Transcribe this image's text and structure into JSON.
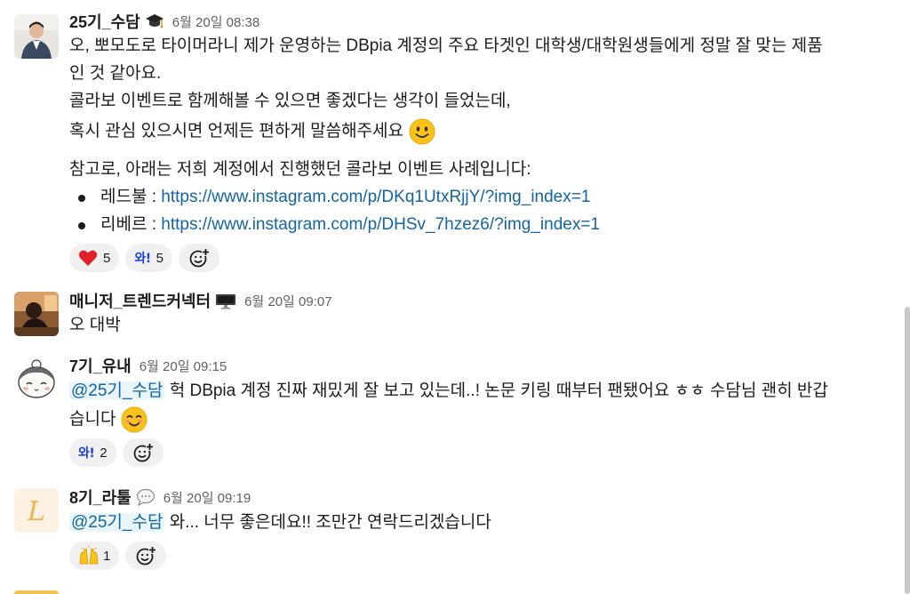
{
  "messages": [
    {
      "author": "25기_수담",
      "status_icon": "graduation-cap-icon",
      "time": "6월 20일 08:38",
      "lines": [
        "오, 뽀모도로 타이머라니 제가 운영하는 DBpia 계정의 주요 타겟인 대학생/대학원생들에게 정말 잘 맞는 제품",
        "인 것 같아요.",
        "콜라보 이벤트로 함께해볼 수 있으면 좋겠다는 생각이 들었는데,",
        "혹시 관심 있으시면 언제든 편하게 말씀해주세요"
      ],
      "paragraph2": "참고로, 아래는 저희 계정에서 진행했던 콜라보 이벤트 사례입니다:",
      "bullets": [
        {
          "label": "레드불 : ",
          "url": "https://www.instagram.com/p/DKq1UtxRjjY/?img_index=1"
        },
        {
          "label": "리베르 : ",
          "url": "https://www.instagram.com/p/DHSv_7hzez6/?img_index=1"
        }
      ],
      "reactions": [
        {
          "emoji": "heart",
          "count": "5"
        },
        {
          "emoji": "와!",
          "count": "5"
        }
      ]
    },
    {
      "author": "매니저_트렌드커넥터",
      "status_icon": "computer-monitor-icon",
      "time": "6월 20일 09:07",
      "text": "오 대박"
    },
    {
      "author": "7기_유내",
      "time": "6월 20일 09:15",
      "mention": "@25기_수담",
      "text_after_mention": " 헉 DBpia 계정 진짜 재밌게 잘 보고 있는데..! 논문 키링 때부터 팬됐어요 ㅎㅎ 수담님 괜히 반갑",
      "line2": "습니다",
      "reactions": [
        {
          "emoji": "와!",
          "count": "2"
        }
      ]
    },
    {
      "author": "8기_라툴",
      "status_icon": "speech-bubble-icon",
      "time": "6월 20일 09:19",
      "mention": "@25기_수담",
      "text_after_mention": " 와... 너무 좋은데요!! 조만간 연락드리겠습니다",
      "reactions": [
        {
          "emoji": "raised-hands",
          "count": "1"
        }
      ],
      "avatar_letter": "L"
    }
  ],
  "colors": {
    "link": "#1264a3",
    "mention_bg": "#e8f5fa",
    "reaction_bg": "#f0f0f0",
    "timestamp": "#616061"
  }
}
